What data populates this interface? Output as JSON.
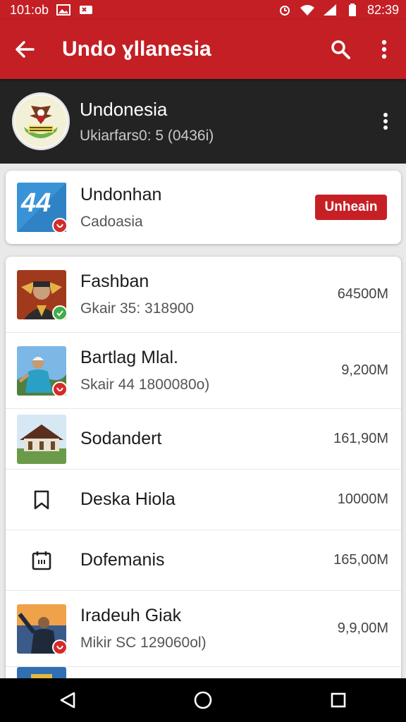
{
  "status_bar": {
    "time_left": "101:ob",
    "time_right": "82:39"
  },
  "app_bar": {
    "title": "Undo ɣllanesia"
  },
  "channel": {
    "name": "Undonesia",
    "subtitle": "Ukiarfars0: 5 (0436i)"
  },
  "featured": {
    "title": "Undonhan",
    "subtitle": "Cadoasia",
    "action_label": "Unheain",
    "thumb_text": "44"
  },
  "rows": [
    {
      "title": "Fashban",
      "subtitle": "Gkair 35: 318900",
      "size": "64500M"
    },
    {
      "title": "Bartlag Mlal.",
      "subtitle": "Skair 44 1800080o)",
      "size": "9,200M"
    },
    {
      "title": "Sodandert",
      "size": "161,90M"
    },
    {
      "title": "Deska Hiola",
      "size": "10000M"
    },
    {
      "title": "Dofemanis",
      "size": "165,00M"
    },
    {
      "title": "Iradeuh Giak",
      "subtitle": "Mikir SC 129060ol)",
      "size": "9,9,00M"
    }
  ],
  "colors": {
    "accent": "#c31f24",
    "channel_bg": "#232323",
    "button": "#c62025"
  }
}
